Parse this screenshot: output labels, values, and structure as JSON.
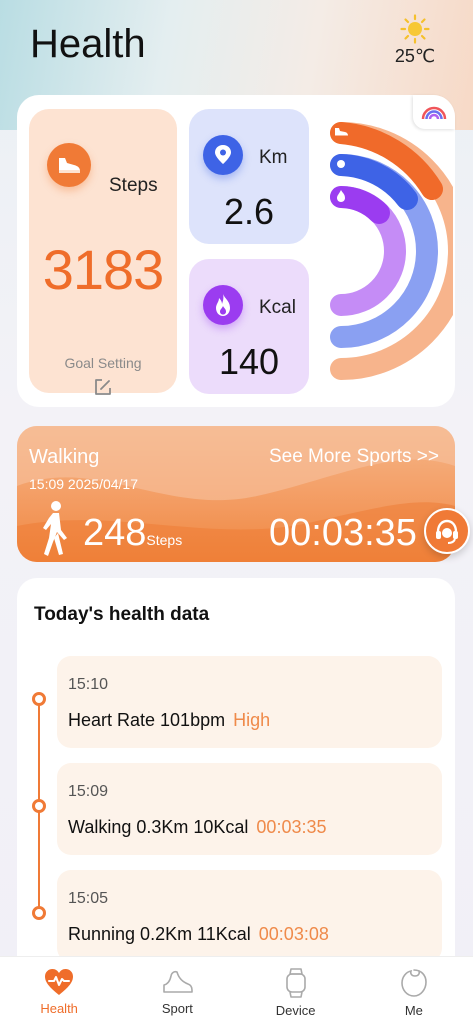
{
  "header": {
    "title": "Health",
    "weather": {
      "temperature": "25℃",
      "icon": "sun-icon"
    }
  },
  "summary": {
    "steps": {
      "label": "Steps",
      "value": "3183",
      "goal_label": "Goal Setting"
    },
    "km": {
      "label": "Km",
      "value": "2.6"
    },
    "kcal": {
      "label": "Kcal",
      "value": "140"
    },
    "rings": [
      {
        "name": "steps",
        "color": "#f06a2a",
        "track": "#f7b48c"
      },
      {
        "name": "distance",
        "color": "#3e63e6",
        "track": "#8aa0f2"
      },
      {
        "name": "calories",
        "color": "#9b3cf0",
        "track": "#c58cf6"
      }
    ]
  },
  "walking": {
    "title": "Walking",
    "time": "15:09 2025/04/17",
    "see_more": "See More Sports >>",
    "steps": "248",
    "steps_unit": "Steps",
    "duration": "00:03:35"
  },
  "health_data": {
    "title": "Today's health data",
    "entries": [
      {
        "time": "15:10",
        "text": "Heart Rate 101bpm",
        "accent": "High"
      },
      {
        "time": "15:09",
        "text": "Walking 0.3Km 10Kcal",
        "accent": "00:03:35"
      },
      {
        "time": "15:05",
        "text": "Running 0.2Km 11Kcal",
        "accent": "00:03:08"
      }
    ]
  },
  "tabs": [
    {
      "label": "Health",
      "icon": "heart-pulse-icon",
      "active": true
    },
    {
      "label": "Sport",
      "icon": "shoe-icon",
      "active": false
    },
    {
      "label": "Device",
      "icon": "watch-icon",
      "active": false
    },
    {
      "label": "Me",
      "icon": "person-icon",
      "active": false
    }
  ],
  "colors": {
    "accent": "#ef6d2a",
    "blue": "#3e63e6",
    "purple": "#9b3cf0"
  }
}
